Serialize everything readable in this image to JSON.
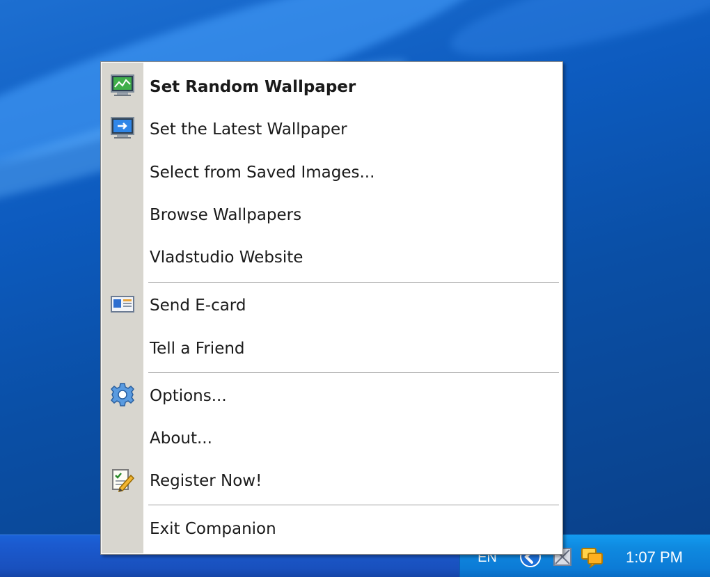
{
  "menu": {
    "items": [
      {
        "label": "Set Random Wallpaper",
        "icon": "monitor-chart-icon",
        "bold": true
      },
      {
        "label": "Set the Latest Wallpaper",
        "icon": "monitor-arrow-icon"
      },
      {
        "label": "Select from Saved Images..."
      },
      {
        "label": "Browse Wallpapers"
      },
      {
        "label": "Vladstudio Website"
      },
      {
        "label": "Send E-card",
        "icon": "ecard-icon"
      },
      {
        "label": "Tell a Friend"
      },
      {
        "label": "Options...",
        "icon": "gear-icon"
      },
      {
        "label": "About..."
      },
      {
        "label": "Register Now!",
        "icon": "notepad-pencil-icon"
      },
      {
        "label": "Exit Companion"
      }
    ]
  },
  "taskbar": {
    "language": "EN",
    "clock": "1:07 PM",
    "tray_icons": [
      "vladstudio-tray-icon",
      "network-icon",
      "messenger-icon"
    ]
  },
  "colors": {
    "menu_gutter": "#d8d6cf",
    "menu_background": "#ffffff",
    "taskbar": "#1b5bd0",
    "tray": "#0f8ae0"
  }
}
